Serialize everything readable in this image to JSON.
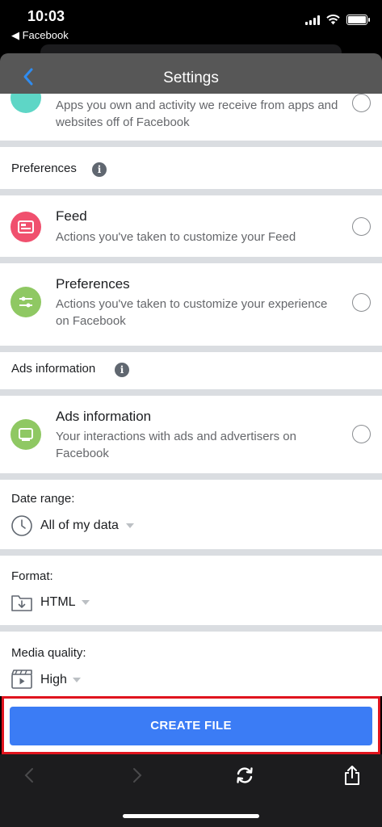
{
  "status": {
    "time": "10:03",
    "back_app": "◀ Facebook"
  },
  "header": {
    "title": "Settings"
  },
  "partial_item": {
    "desc": "Apps you own and activity we receive from apps and websites off of Facebook"
  },
  "sections": {
    "preferences": {
      "title": "Preferences",
      "info": "i"
    },
    "ads": {
      "title": "Ads information",
      "info": "i"
    }
  },
  "items": {
    "feed": {
      "title": "Feed",
      "desc": "Actions you've taken to customize your Feed"
    },
    "preferences": {
      "title": "Preferences",
      "desc": "Actions you've taken to customize your experience on Facebook"
    },
    "ads": {
      "title": "Ads information",
      "desc": "Your interactions with ads and advertisers on Facebook"
    }
  },
  "options": {
    "date_range": {
      "label": "Date range:",
      "value": "All of my data"
    },
    "format": {
      "label": "Format:",
      "value": "HTML"
    },
    "media_quality": {
      "label": "Media quality:",
      "value": "High"
    }
  },
  "actions": {
    "create_file": "CREATE FILE"
  },
  "colors": {
    "accent": "#3b7cf5",
    "feed_icon": "#f0506e",
    "preferences_icon": "#8fc863",
    "ads_icon": "#8fc863",
    "highlight": "#e0141e"
  },
  "icons": {
    "feed": "feed-icon",
    "preferences": "sliders-icon",
    "ads": "ads-screen-icon",
    "date_range": "clock-icon",
    "format": "folder-download-icon",
    "media_quality": "video-clapper-icon"
  }
}
